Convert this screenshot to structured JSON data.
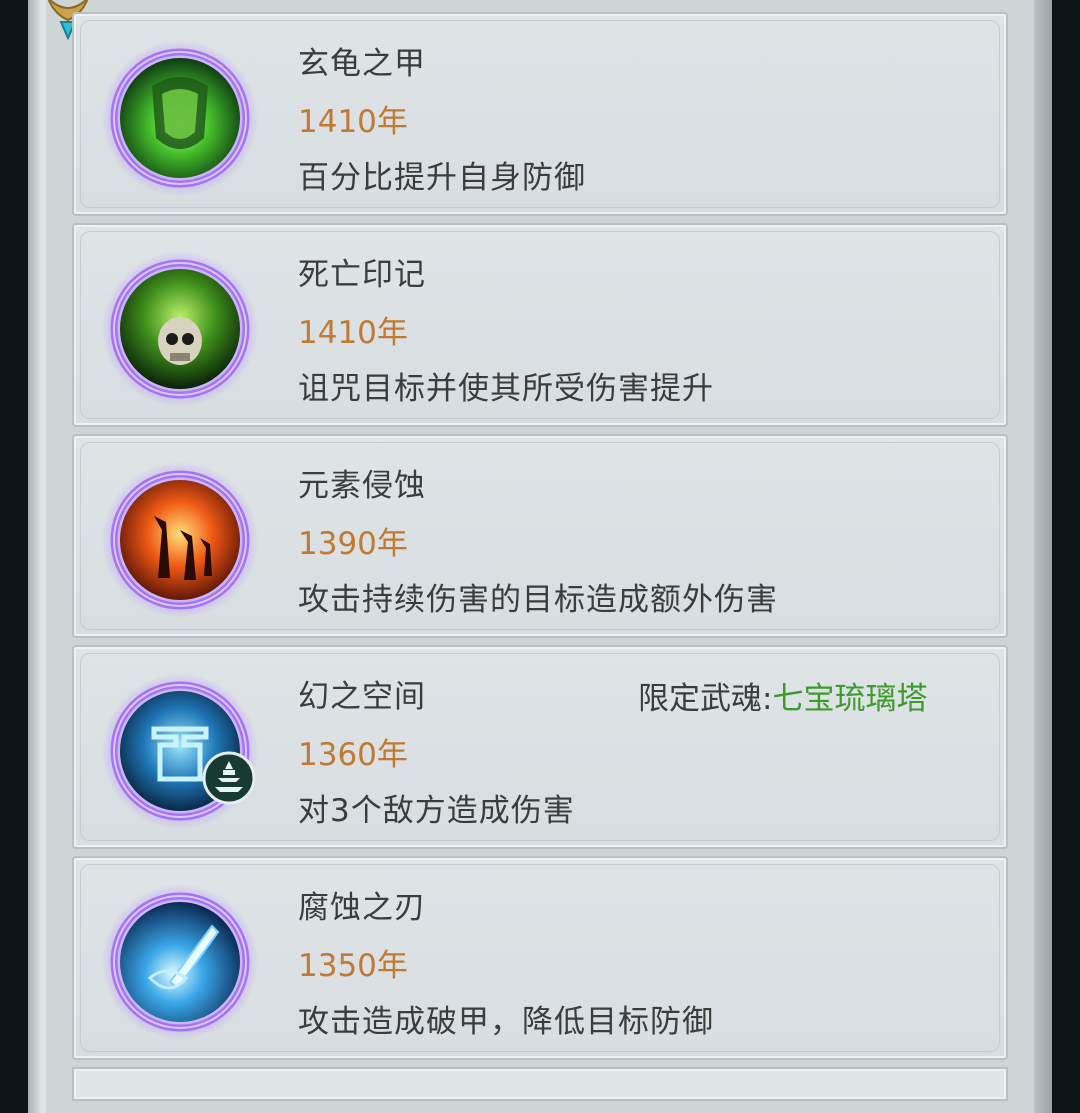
{
  "skills": [
    {
      "name": "玄龟之甲",
      "years": "1410年",
      "desc": "百分比提升自身防御",
      "icon": "green-armor-icon",
      "theme": "#5fd03a"
    },
    {
      "name": "死亡印记",
      "years": "1410年",
      "desc": "诅咒目标并使其所受伤害提升",
      "icon": "skull-mark-icon",
      "theme": "#7ccf3a"
    },
    {
      "name": "元素侵蚀",
      "years": "1390年",
      "desc": "攻击持续伤害的目标造成额外伤害",
      "icon": "fire-erosion-icon",
      "theme": "#ff6a1a"
    },
    {
      "name": "幻之空间",
      "years": "1360年",
      "desc": "对3个敌方造成伤害",
      "icon": "illusion-space-icon",
      "theme": "#2aa8e8",
      "restriction_label": "限定武魂:",
      "restriction_value": "七宝琉璃塔",
      "badge_icon": "pagoda-badge-icon"
    },
    {
      "name": "腐蚀之刃",
      "years": "1350年",
      "desc": "攻击造成破甲，降低目标防御",
      "icon": "corrosion-blade-icon",
      "theme": "#3aa4e6"
    }
  ],
  "colors": {
    "name_text": "#3c3c3c",
    "years_text": "#c07a33",
    "restriction_value": "#3f9a2d",
    "ring": "#a474f2"
  }
}
